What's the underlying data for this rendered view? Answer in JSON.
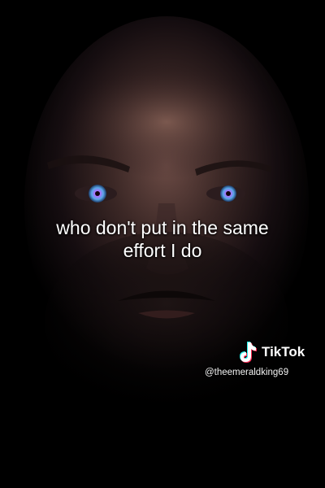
{
  "caption": {
    "line1": "who don't put in the same",
    "line2": "effort I do"
  },
  "watermark": {
    "brand": "TikTok",
    "handle": "@theemeraldking69",
    "logo_icon": "tiktok-note-icon"
  },
  "colors": {
    "background": "#000000",
    "eye_iris": "#5aa8e8",
    "text": "#ffffff"
  }
}
